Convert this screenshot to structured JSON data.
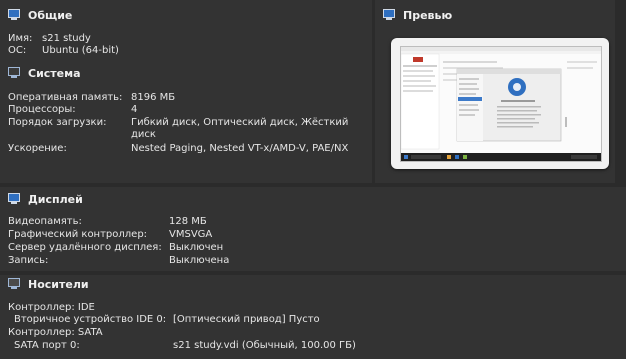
{
  "general": {
    "title": "Общие",
    "rows": [
      {
        "key": "Имя:",
        "value": "s21 study"
      },
      {
        "key": "ОС:",
        "value": "Ubuntu (64-bit)"
      }
    ]
  },
  "system": {
    "title": "Система",
    "rows": [
      {
        "key": "Оперативная память:",
        "value": "8196 МБ"
      },
      {
        "key": "Процессоры:",
        "value": "4"
      },
      {
        "key": "Порядок загрузки:",
        "value": "Гибкий диск, Оптический диск, Жёсткий",
        "value2": "диск"
      },
      {
        "key": "Ускорение:",
        "value": "Nested Paging, Nested VT-x/AMD-V, PAE/NX"
      }
    ]
  },
  "preview": {
    "title": "Превью"
  },
  "display": {
    "title": "Дисплей",
    "rows": [
      {
        "key": "Видеопамять:",
        "value": "128 МБ"
      },
      {
        "key": "Графический контроллер:",
        "value": "VMSVGA"
      },
      {
        "key": "Сервер удалённого дисплея:",
        "value": "Выключен"
      },
      {
        "key": "Запись:",
        "value": "Выключена"
      }
    ]
  },
  "storage": {
    "title": "Носители",
    "rows": [
      {
        "key": "Контроллер: IDE",
        "value": ""
      },
      {
        "key": "Вторичное устройство IDE 0:",
        "value": "[Оптический привод] Пусто"
      },
      {
        "key": "Контроллер: SATA",
        "value": ""
      },
      {
        "key": "SATA порт 0:",
        "value": "s21 study.vdi (Обычный, 100.00 ГБ)"
      }
    ]
  },
  "colors": {
    "background": "#2b2b2b",
    "panel": "#333333",
    "icon_accent": "#2f6fc0"
  }
}
